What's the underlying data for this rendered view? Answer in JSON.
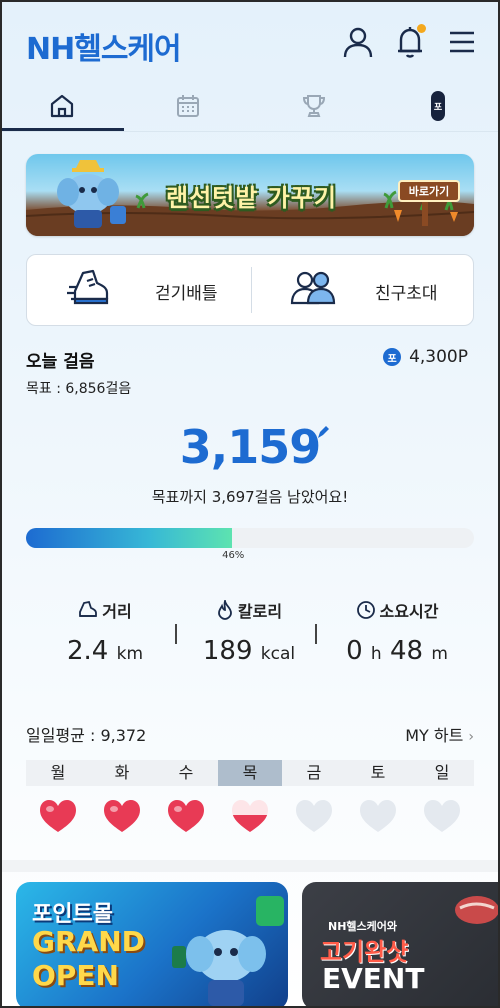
{
  "header": {
    "logo": "NH헬스케어",
    "icons": [
      "user-icon",
      "bell-icon",
      "menu-icon"
    ]
  },
  "tabs": [
    {
      "icon": "home-icon",
      "active": true
    },
    {
      "icon": "calendar-icon",
      "active": false
    },
    {
      "icon": "trophy-icon",
      "active": false
    },
    {
      "icon": "point-icon",
      "label": "포",
      "active": false
    }
  ],
  "banner": {
    "title": "랜선텃밭 가꾸기",
    "button": "바로가기"
  },
  "actions": {
    "walk_battle": "걷기배틀",
    "invite_friend": "친구초대"
  },
  "today": {
    "title": "오늘 걸음",
    "goal": "목표 : 6,856걸음",
    "points_badge": "포",
    "points": "4,300P",
    "steps": "3,159",
    "remaining": "목표까지 3,697걸음 남았어요!",
    "progress_percent": 46,
    "progress_label": "46%"
  },
  "stats": {
    "distance": {
      "label": "거리",
      "value": "2.4",
      "unit": "km"
    },
    "calories": {
      "label": "칼로리",
      "value": "189",
      "unit": "kcal"
    },
    "time": {
      "label": "소요시간",
      "h": "0",
      "h_unit": "h",
      "m": "48",
      "m_unit": "m"
    }
  },
  "week": {
    "average": "일일평균 : 9,372",
    "my_heart": "MY 하트",
    "days": [
      "월",
      "화",
      "수",
      "목",
      "금",
      "토",
      "일"
    ],
    "active_day": 3,
    "hearts": [
      "full",
      "full",
      "full",
      "half",
      "empty",
      "empty",
      "empty"
    ]
  },
  "promos": {
    "p1_line1": "포인트몰",
    "p1_line2": "GRAND",
    "p1_line3": "OPEN",
    "p2_small": "NH헬스케어와",
    "p2_big": "고기완샷",
    "p2_event": "EVENT"
  },
  "colors": {
    "brand": "#1d6bd1",
    "heart_full": "#e83a55",
    "heart_empty": "#e4e9ef"
  }
}
